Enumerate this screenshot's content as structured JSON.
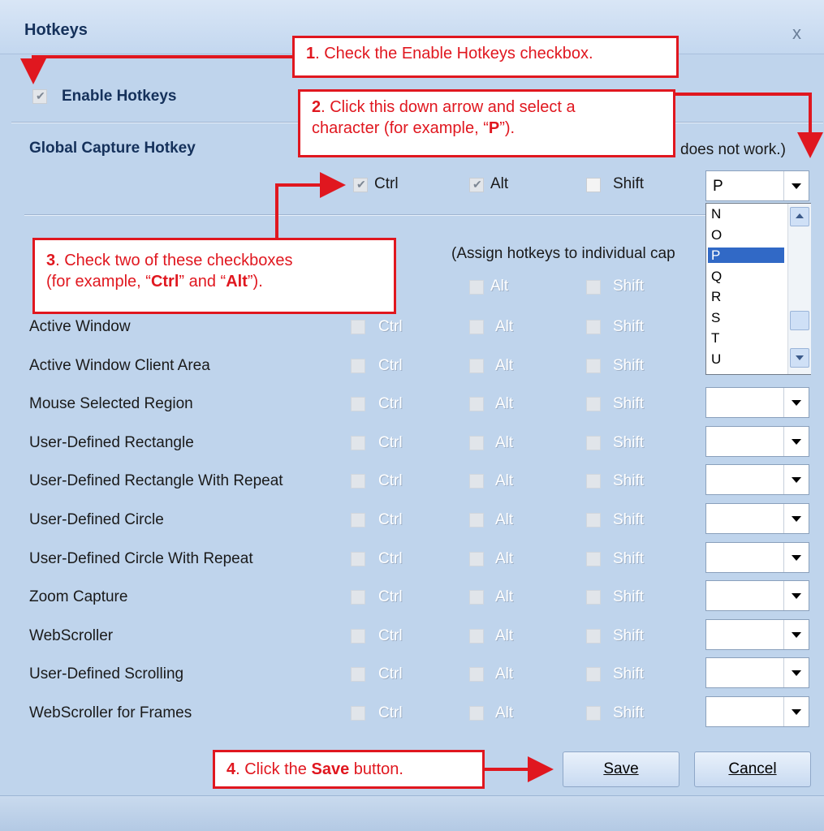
{
  "dialog": {
    "title": "Hotkeys",
    "close_glyph": "x",
    "enable_label": "Enable Hotkeys",
    "global_label": "Global Capture Hotkey",
    "global_note": "does not work.)",
    "individual_note": "(Assign hotkeys to individual cap",
    "modifier_labels": {
      "ctrl": "Ctrl",
      "alt": "Alt",
      "shift": "Shift"
    },
    "global_key_value": "P",
    "rows": [
      "Active Window",
      "Active Window Client Area",
      "Mouse Selected Region",
      "User-Defined Rectangle",
      "User-Defined Rectangle With Repeat",
      "User-Defined Circle",
      "User-Defined Circle With Repeat",
      "Zoom Capture",
      "WebScroller",
      "User-Defined Scrolling",
      "WebScroller for Frames"
    ],
    "dropdown_items": [
      "N",
      "O",
      "P",
      "Q",
      "R",
      "S",
      "T",
      "U"
    ],
    "dropdown_selected": "P",
    "save_label": "Save",
    "cancel_label": "Cancel"
  },
  "callouts": {
    "c1": {
      "num": "1",
      "text": ". Check the Enable Hotkeys checkbox."
    },
    "c2": {
      "num": "2",
      "text1": ". Click this down arrow and select a",
      "text2a": "character (for example, “",
      "key": "P",
      "text2b": "”)."
    },
    "c3": {
      "num": "3",
      "text1": ". Check two of these checkboxes",
      "text2a": "(for example, “",
      "k1": "Ctrl",
      "text2b": "” and “",
      "k2": "Alt",
      "text2c": "”)."
    },
    "c4": {
      "num": "4",
      "text1": ". Click the ",
      "key": "Save",
      "text2": " button."
    }
  },
  "colors": {
    "callout_red": "#e0171f",
    "dialog_bg": "#bfd4ec",
    "selection_blue": "#3169c6"
  },
  "icons": {
    "checkmark": "check-icon",
    "dropdown": "chevron-down-icon",
    "close": "close-icon"
  }
}
